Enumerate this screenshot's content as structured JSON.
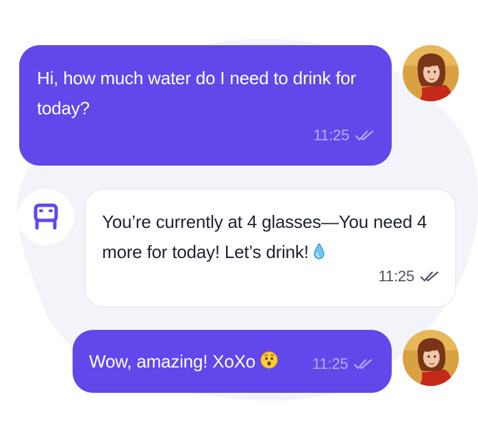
{
  "chat": {
    "messages": [
      {
        "sender": "user",
        "text": "Hi, how much water do I need to drink for today?",
        "time": "11:25",
        "status_icon": "double-check-icon"
      },
      {
        "sender": "bot",
        "text": "You’re currently at 4 glasses—You need 4 more for today! Let’s drink!",
        "trailing_icon": "water-drop-icon",
        "time": "11:25",
        "status_icon": "double-check-icon"
      },
      {
        "sender": "user",
        "text": "Wow, amazing! XoXo",
        "trailing_icon": "astonished-face-emoji",
        "time": "11:25",
        "status_icon": "double-check-icon"
      }
    ]
  },
  "colors": {
    "user_bubble": "#6247ea",
    "bot_bubble": "#ffffff",
    "bot_icon": "#6247ea",
    "background_blob": "#f2f4f9"
  }
}
